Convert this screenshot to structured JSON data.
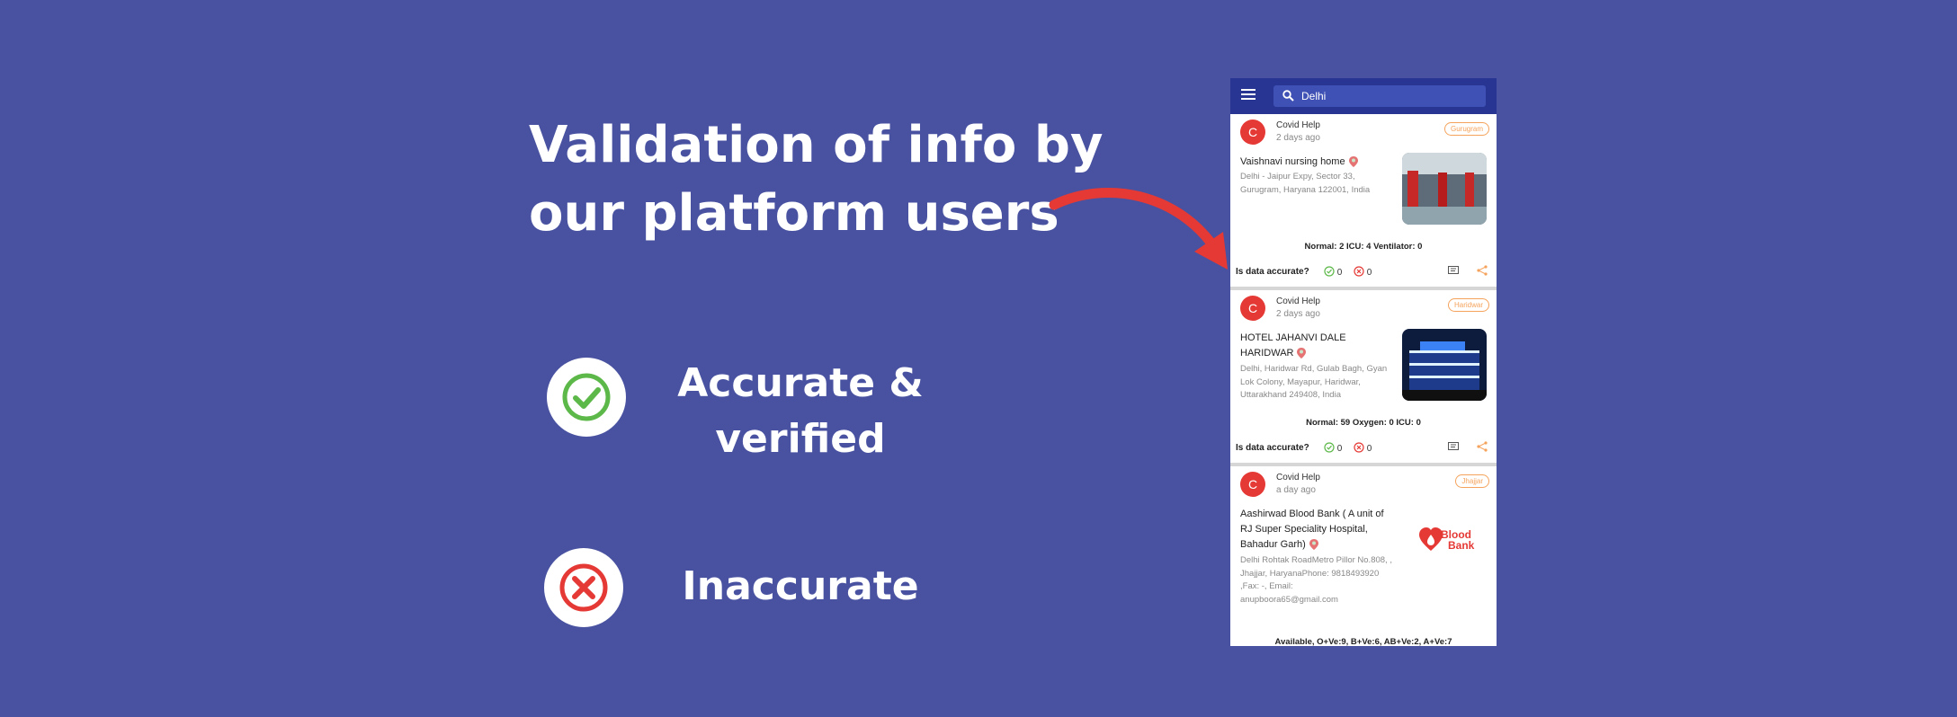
{
  "headline": [
    "Validation of info by",
    "our platform users"
  ],
  "legend": {
    "accurate": [
      "Accurate &",
      "verified"
    ],
    "inaccurate": "Inaccurate"
  },
  "colors": {
    "background": "#4852a0",
    "appbar": "#283593",
    "accurate": "#5cb848",
    "inaccurate": "#e53935",
    "tag": "#f5a35c",
    "arrow": "#e53935"
  },
  "app": {
    "search_value": "Delhi",
    "accuracy_prompt": "Is data accurate?",
    "cards": [
      {
        "avatar": "C",
        "author": "Covid Help",
        "ago": "2 days ago",
        "tag": "Gurugram",
        "title": [
          "Vaishnavi nursing home"
        ],
        "address": [
          "Delhi - Jaipur Expy, Sector 33,",
          "Gurugram, Haryana 122001, India"
        ],
        "stats": "Normal: 2 ICU: 4 Ventilator: 0",
        "accurate_count": "0",
        "inaccurate_count": "0"
      },
      {
        "avatar": "C",
        "author": "Covid Help",
        "ago": "2 days ago",
        "tag": "Haridwar",
        "title": [
          "HOTEL JAHANVI DALE",
          "HARIDWAR"
        ],
        "address": [
          "Delhi, Haridwar Rd, Gulab Bagh, Gyan",
          "Lok Colony, Mayapur, Haridwar,",
          "Uttarakhand 249408, India"
        ],
        "stats": "Normal: 59 Oxygen: 0 ICU: 0",
        "accurate_count": "0",
        "inaccurate_count": "0"
      },
      {
        "avatar": "C",
        "author": "Covid Help",
        "ago": "a day ago",
        "tag": "Jhajjar",
        "title": [
          "Aashirwad Blood Bank ( A unit of",
          "RJ Super Speciality Hospital,",
          "Bahadur Garh)"
        ],
        "address": [
          "Delhi Rohtak RoadMetro Pillor No.808, ,",
          "Jhajjar, HaryanaPhone: 9818493920",
          ",Fax: -, Email:",
          "anupboora65@gmail.com"
        ],
        "stats": "Available, O+Ve:9, B+Ve:6, AB+Ve:2, A+Ve:7",
        "logo_text": [
          "Blood",
          "Bank"
        ]
      }
    ]
  }
}
